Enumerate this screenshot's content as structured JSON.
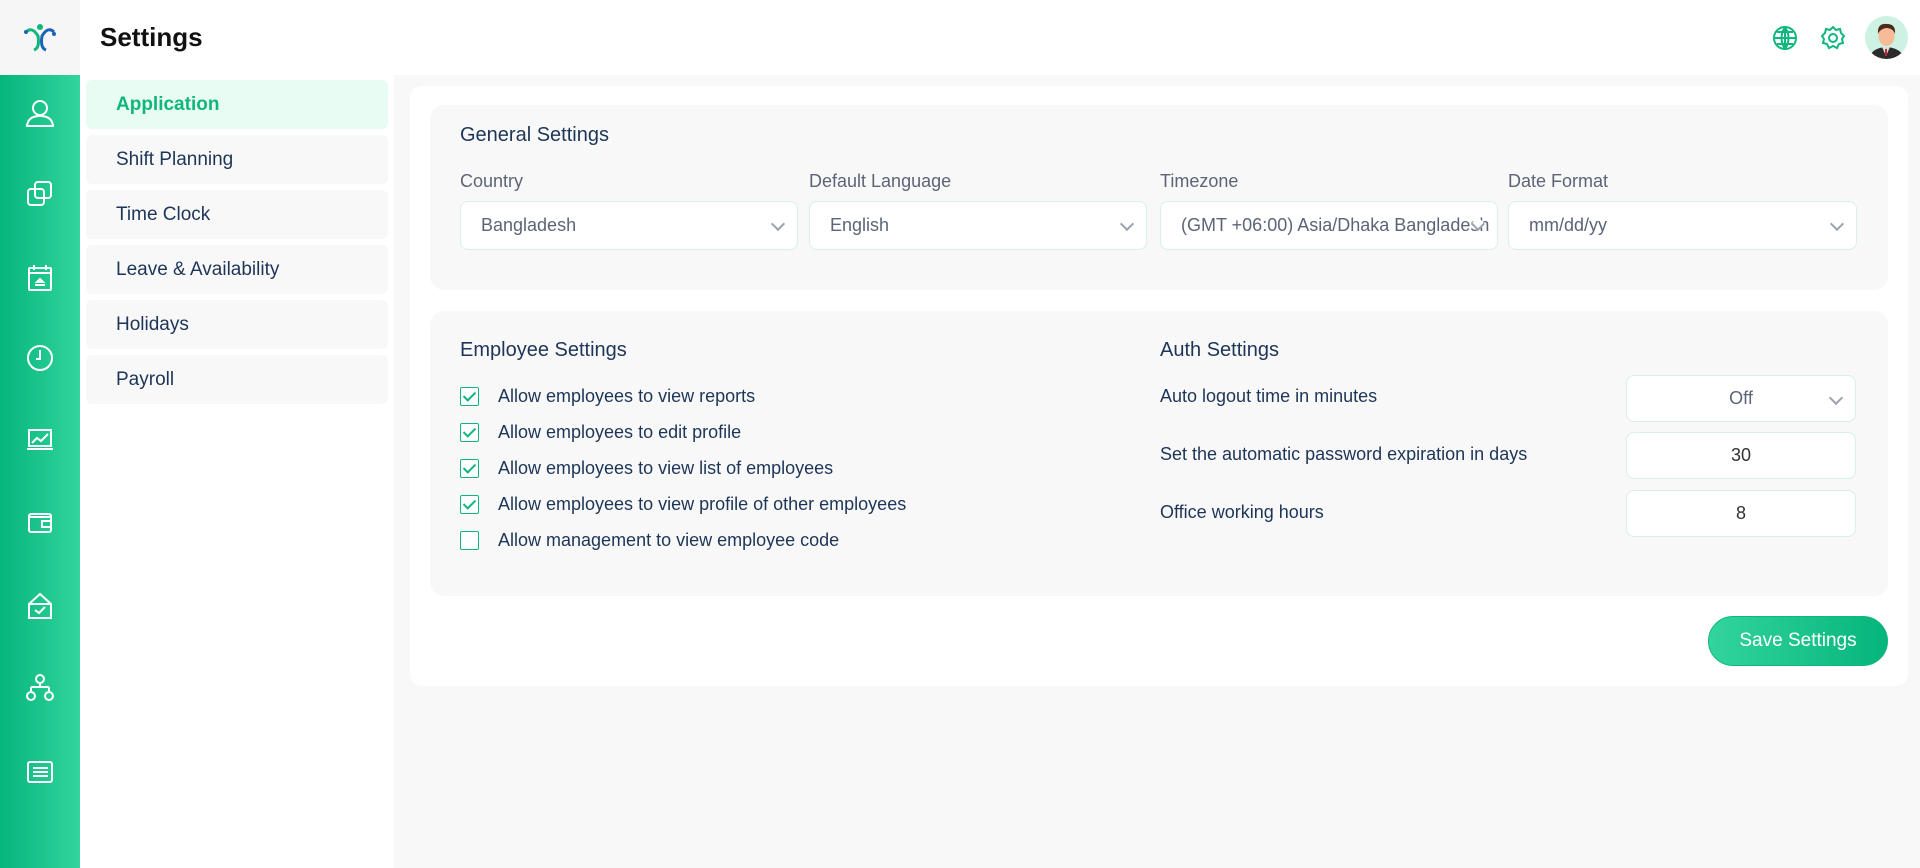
{
  "header": {
    "title": "Settings"
  },
  "colors": {
    "accent": "#0fb77c",
    "rail_start": "#05b57b",
    "rail_end": "#33d49e"
  },
  "rail": {
    "icons": [
      "user-icon",
      "layers-icon",
      "calendar-icon",
      "clock-icon",
      "chart-icon",
      "wallet-icon",
      "inbox-check-icon",
      "org-chart-icon",
      "list-icon"
    ]
  },
  "submenu": {
    "items": [
      {
        "label": "Application",
        "active": true
      },
      {
        "label": "Shift Planning"
      },
      {
        "label": "Time Clock"
      },
      {
        "label": "Leave & Availability"
      },
      {
        "label": "Holidays"
      },
      {
        "label": "Payroll"
      }
    ]
  },
  "general": {
    "title": "General Settings",
    "fields": [
      {
        "label": "Country",
        "value": "Bangladesh"
      },
      {
        "label": "Default Language",
        "value": "English"
      },
      {
        "label": "Timezone",
        "value": "(GMT +06:00) Asia/Dhaka Bangladesh"
      },
      {
        "label": "Date Format",
        "value": "mm/dd/yy"
      }
    ]
  },
  "employee": {
    "title": "Employee Settings",
    "options": [
      {
        "label": "Allow employees to view reports",
        "checked": true
      },
      {
        "label": "Allow employees to edit profile",
        "checked": true
      },
      {
        "label": "Allow employees to view list of employees",
        "checked": true
      },
      {
        "label": "Allow employees to view profile of other employees",
        "checked": true
      },
      {
        "label": "Allow management to view employee code",
        "checked": false
      }
    ]
  },
  "auth": {
    "title": "Auth Settings",
    "rows": [
      {
        "label": "Auto logout time in minutes",
        "value": "Off"
      },
      {
        "label": "Set the automatic password expiration in days",
        "value": "30"
      },
      {
        "label": "Office working hours",
        "value": "8"
      }
    ]
  },
  "actions": {
    "save": "Save Settings"
  }
}
